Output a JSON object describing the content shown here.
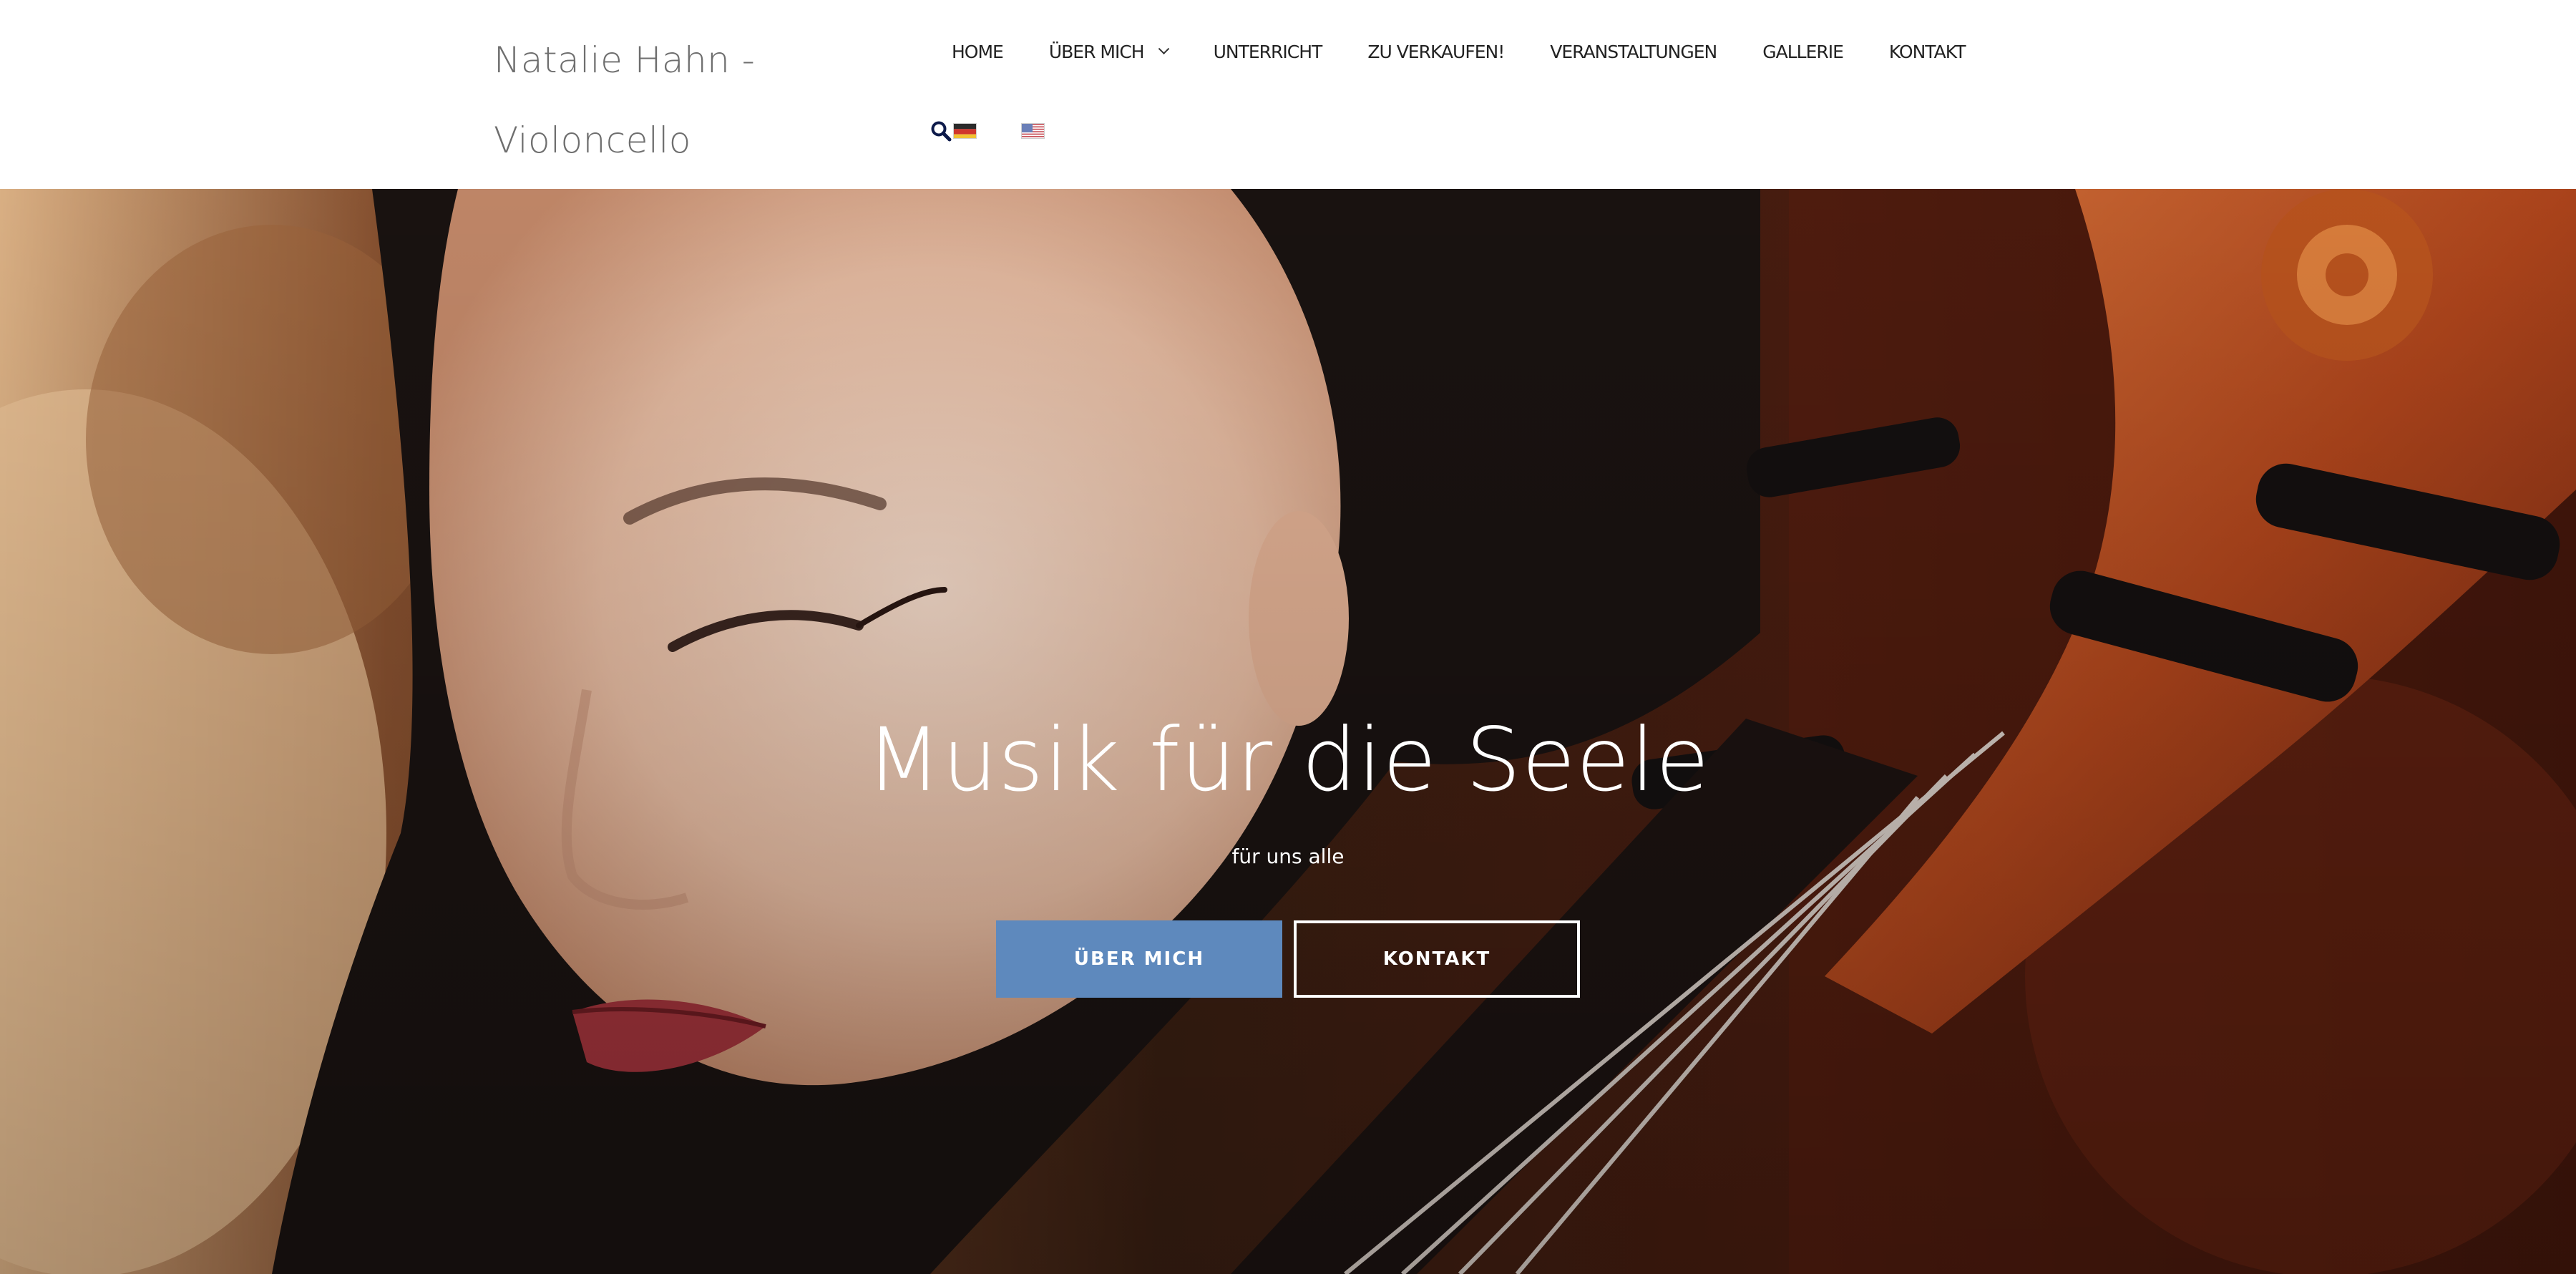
{
  "brand": {
    "line1": "Natalie Hahn -",
    "line2": "Violoncello"
  },
  "nav": {
    "items": [
      {
        "label": "HOME"
      },
      {
        "label": "ÜBER MICH"
      },
      {
        "label": "UNTERRICHT"
      },
      {
        "label": "ZU VERKAUFEN!"
      },
      {
        "label": "VERANSTALTUNGEN"
      },
      {
        "label": "GALLERIE"
      },
      {
        "label": "KONTAKT"
      }
    ],
    "icons": {
      "search": "search-icon",
      "lang_de": "german-flag-icon",
      "lang_en": "us-flag-icon"
    }
  },
  "hero": {
    "title": "Musik für die Seele",
    "subtitle": "für uns alle",
    "primary_button": "ÜBER MICH",
    "secondary_button": "KONTAKT"
  },
  "colors": {
    "accent": "#5e89bd",
    "brand_text": "#6e6e6e",
    "nav_text": "#222222",
    "hero_text": "#ffffff"
  }
}
